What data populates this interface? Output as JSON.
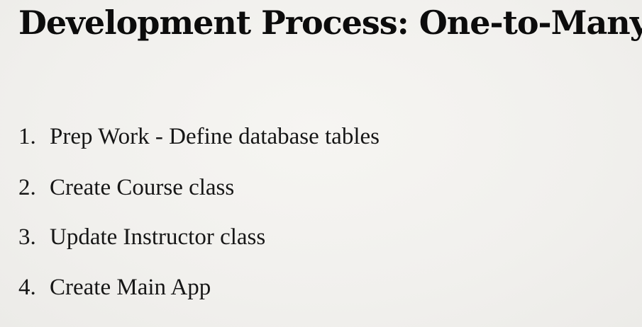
{
  "slide": {
    "title": "Development Process: One-to-Many",
    "steps": [
      {
        "number": "1.",
        "text": "Prep Work - Define database tables"
      },
      {
        "number": "2.",
        "text": "Create Course class"
      },
      {
        "number": "3.",
        "text": "Update Instructor class"
      },
      {
        "number": "4.",
        "text": "Create Main App"
      }
    ]
  }
}
